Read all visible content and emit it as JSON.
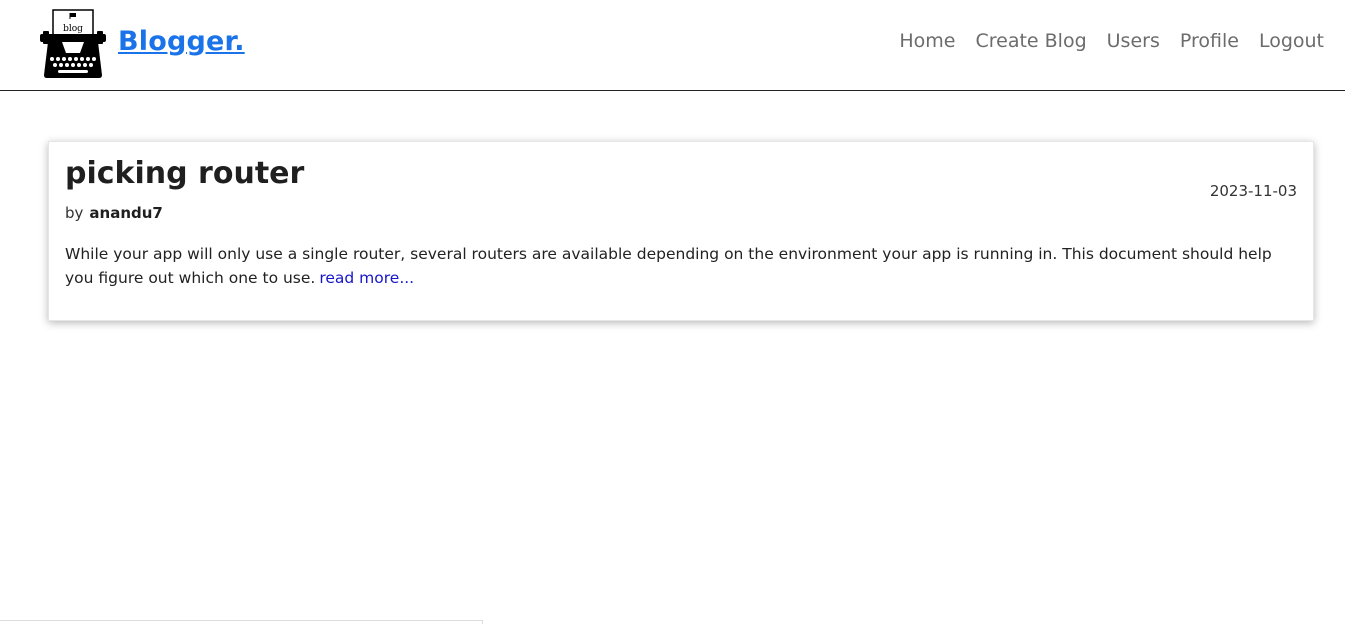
{
  "header": {
    "brand": "Blogger.",
    "logo_text": "blog",
    "nav": [
      "Home",
      "Create Blog",
      "Users",
      "Profile",
      "Logout"
    ]
  },
  "post": {
    "title": "picking router",
    "date": "2023-11-03",
    "by_label": "by",
    "author": "anandu7",
    "excerpt": "While your app will only use a single router, several routers are available depending on the environment your app is running in. This document should help you figure out which one to use.",
    "read_more": "read more..."
  },
  "colors": {
    "brand": "#1a73e8",
    "nav_text": "#6c6c6c",
    "link": "#1616c9"
  }
}
